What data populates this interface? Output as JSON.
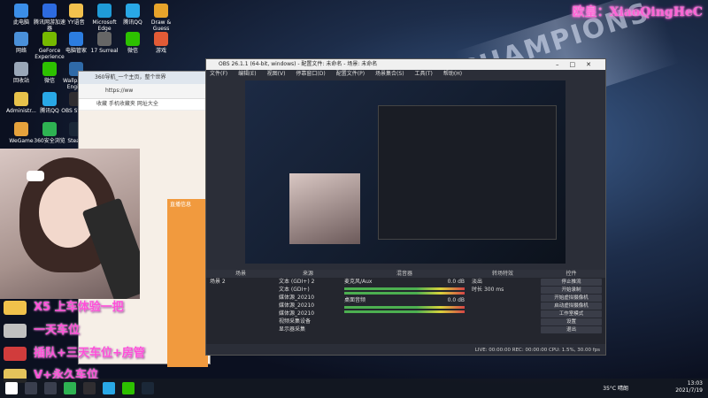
{
  "watermark": "欧皇：XiaoQingHeC",
  "desktop_icons": [
    {
      "label": "此电脑",
      "color": "#3b8ee8"
    },
    {
      "label": "腾讯网游加速器",
      "color": "#2d6be0"
    },
    {
      "label": "YY语音",
      "color": "#f2c14e"
    },
    {
      "label": "Microsoft Edge",
      "color": "#1f9bd7"
    },
    {
      "label": "腾讯QQ",
      "color": "#29a8e6"
    },
    {
      "label": "Draw & Guess",
      "color": "#e7a42b"
    },
    {
      "label": "网络",
      "color": "#4a90d9"
    },
    {
      "label": "GeForce Experience",
      "color": "#76b900"
    },
    {
      "label": "电脑管家",
      "color": "#2c7de0"
    },
    {
      "label": "17 Surreal",
      "color": "#666"
    },
    {
      "label": "微信",
      "color": "#2dc100"
    },
    {
      "label": "游戏",
      "color": "#e25b36"
    },
    {
      "label": "回收站",
      "color": "#9aa7b8"
    },
    {
      "label": "微信",
      "color": "#2dc100"
    },
    {
      "label": "Wallpaper Engine",
      "color": "#2f6aa8"
    },
    {
      "label": "Administr...",
      "color": "#e7c24b"
    },
    {
      "label": "腾讯QQ",
      "color": "#29a8e6"
    },
    {
      "label": "WeGame",
      "color": "#e6a23c"
    },
    {
      "label": "360安全浏览",
      "color": "#2eb352"
    },
    {
      "label": "Steam",
      "color": "#1b2838"
    },
    {
      "label": "OBS Studio",
      "color": "#302e31"
    }
  ],
  "browser": {
    "tab_title": "360导航_一个主页，整个世界",
    "address": "https://ww",
    "bookmarks": "收藏  手机收藏夹  网址大全",
    "panel_title": "直播信息"
  },
  "obs": {
    "title": "OBS 26.1.1 (64-bit, windows) - 配置文件: 未命名 - 场景: 未命名",
    "menu": [
      "文件(F)",
      "编辑(E)",
      "视图(V)",
      "停靠窗口(D)",
      "配置文件(P)",
      "场景集合(S)",
      "工具(T)",
      "帮助(H)"
    ],
    "panels": {
      "scenes_header": "场景",
      "scenes": [
        "场景 2"
      ],
      "sources_header": "来源",
      "sources": [
        "文本 (GDI+) 2",
        "文本 (GDI+)",
        "媒体源_20210",
        "媒体源_20210",
        "媒体源_20210",
        "视频采集设备",
        "显示器采集"
      ],
      "mixer_header": "混音器",
      "mixer": [
        {
          "name": "麦克风/Aux",
          "db": "0.0 dB"
        },
        {
          "name": "桌面音频",
          "db": "0.0 dB"
        }
      ],
      "transitions_header": "转场特效",
      "transition": "淡出",
      "duration_label": "时长",
      "duration": "300 ms",
      "controls_header": "控件",
      "controls": [
        "停止推流",
        "开始录制",
        "开始虚拟摄像机",
        "启动虚拟摄像机",
        "工作室模式",
        "设置",
        "退出"
      ]
    },
    "status": "LIVE: 00:00:00   REC: 00:00:00   CPU: 1.5%, 30.00 fps"
  },
  "promos": [
    {
      "text": "X5 上车体验一把",
      "color": "#f0c24b"
    },
    {
      "text": "一天车位",
      "color": "#c0c0c0"
    },
    {
      "text": "插队+三天车位+房管",
      "color": "#d13c3c"
    },
    {
      "text": "V+永久车位",
      "color": "#e4c35b"
    }
  ],
  "taskbar": {
    "weather": "35°C 晴朗",
    "time": "13:03",
    "date": "2021/7/19"
  }
}
